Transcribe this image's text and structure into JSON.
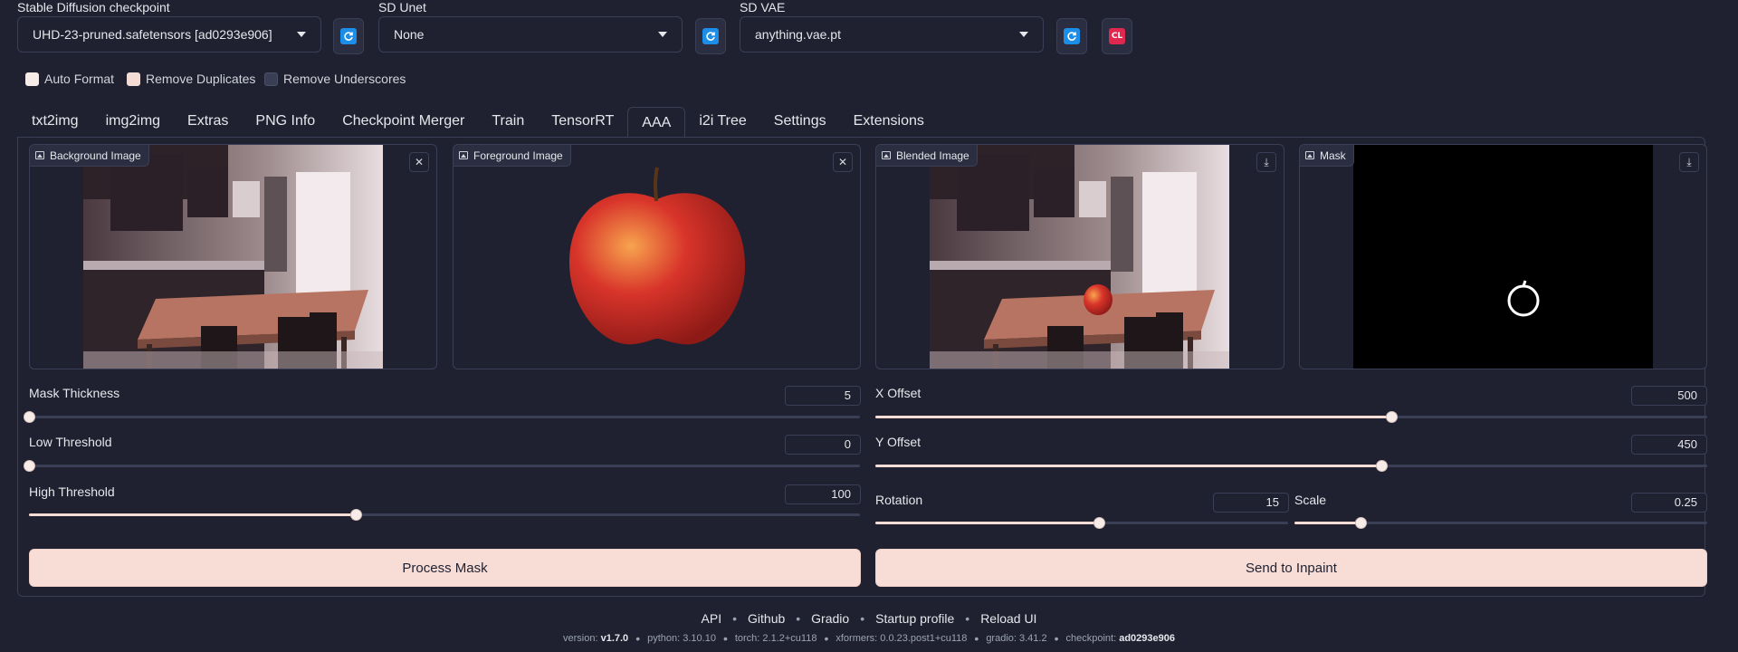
{
  "settings": {
    "checkpoint_label": "Stable Diffusion checkpoint",
    "checkpoint_value": "UHD-23-pruned.safetensors [ad0293e906]",
    "unet_label": "SD Unet",
    "unet_value": "None",
    "vae_label": "SD VAE",
    "vae_value": "anything.vae.pt",
    "clear_button": "CL",
    "refresh_icon": "refresh-icon"
  },
  "options": {
    "auto_format": "Auto Format",
    "remove_duplicates": "Remove Duplicates",
    "remove_underscores": "Remove Underscores",
    "auto_format_checked": true,
    "remove_duplicates_checked": true,
    "remove_underscores_checked": false
  },
  "tabs": [
    "txt2img",
    "img2img",
    "Extras",
    "PNG Info",
    "Checkpoint Merger",
    "Train",
    "TensorRT",
    "AAA",
    "i2i Tree",
    "Settings",
    "Extensions"
  ],
  "active_tab": "AAA",
  "images": {
    "background": "Background Image",
    "foreground": "Foreground Image",
    "blended": "Blended Image",
    "mask": "Mask"
  },
  "sliders": {
    "mask_thickness": {
      "label": "Mask Thickness",
      "value": "5",
      "fraction": 0.0
    },
    "low_threshold": {
      "label": "Low Threshold",
      "value": "0",
      "fraction": 0.0
    },
    "high_threshold": {
      "label": "High Threshold",
      "value": "100",
      "fraction": 0.393
    },
    "x_offset": {
      "label": "X Offset",
      "value": "500",
      "fraction": 0.62
    },
    "y_offset": {
      "label": "Y Offset",
      "value": "450",
      "fraction": 0.608
    },
    "rotation": {
      "label": "Rotation",
      "value": "15",
      "fraction": 0.542
    },
    "scale": {
      "label": "Scale",
      "value": "0.25",
      "fraction": 0.159
    }
  },
  "buttons": {
    "process_mask": "Process Mask",
    "send_to_inpaint": "Send to Inpaint"
  },
  "footer": {
    "links": [
      "API",
      "Github",
      "Gradio",
      "Startup profile",
      "Reload UI"
    ],
    "version_label": "version:",
    "version": "v1.7.0",
    "python": "python: 3.10.10",
    "torch": "torch: 2.1.2+cu118",
    "xformers": "xformers: 0.0.23.post1+cu118",
    "gradio": "gradio: 3.41.2",
    "checkpoint_label": "checkpoint:",
    "checkpoint": "ad0293e906"
  }
}
